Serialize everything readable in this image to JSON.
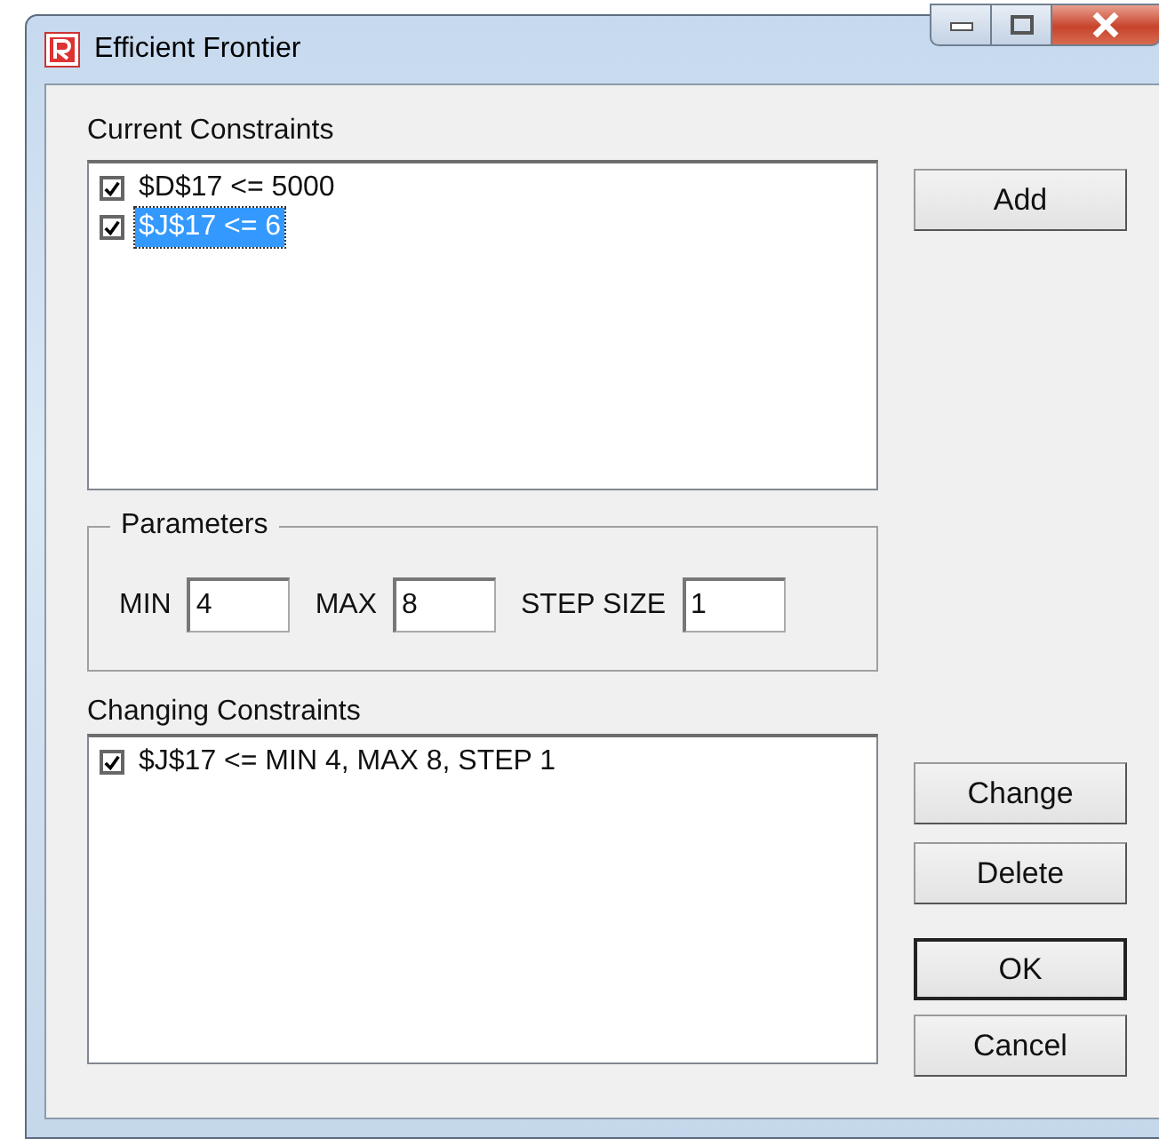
{
  "window": {
    "title": "Efficient Frontier"
  },
  "current_constraints": {
    "label": "Current Constraints",
    "items": [
      {
        "text": "$D$17 <= 5000",
        "checked": true,
        "selected": false
      },
      {
        "text": "$J$17 <= 6",
        "checked": true,
        "selected": true
      }
    ]
  },
  "add_button": {
    "label": "Add"
  },
  "parameters": {
    "label": "Parameters",
    "fields": [
      {
        "label": "MIN",
        "value": "4"
      },
      {
        "label": "MAX",
        "value": "8"
      },
      {
        "label": "STEP SIZE",
        "value": "1"
      }
    ]
  },
  "changing_constraints": {
    "label": "Changing Constraints",
    "items": [
      {
        "text": "$J$17 <= MIN 4, MAX 8, STEP 1",
        "checked": true,
        "selected": false
      }
    ]
  },
  "buttons": [
    {
      "label": "Change",
      "default": false
    },
    {
      "label": "Delete",
      "default": false
    },
    {
      "label": "OK",
      "default": true
    },
    {
      "label": "Cancel",
      "default": false
    }
  ]
}
